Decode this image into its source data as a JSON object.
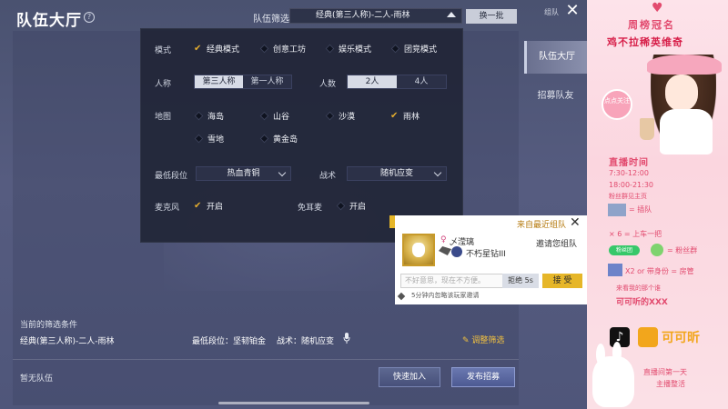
{
  "header": {
    "title": "队伍大厅",
    "help_icon": "help-circle-icon",
    "filter_label": "队伍筛选",
    "filter_value": "经典(第三人称)-二人-雨林",
    "refresh_label": "换一批",
    "tab_small": "组队",
    "close_icon": "close-icon"
  },
  "side_tabs": [
    {
      "label": "队伍大厅",
      "active": true
    },
    {
      "label": "招募队友",
      "active": false
    }
  ],
  "filter": {
    "mode": {
      "label": "模式",
      "options": [
        {
          "label": "经典模式",
          "checked": true
        },
        {
          "label": "创意工坊",
          "checked": false
        },
        {
          "label": "娱乐模式",
          "checked": false
        },
        {
          "label": "团竞模式",
          "checked": false
        }
      ]
    },
    "perspective": {
      "label": "人称",
      "options": [
        {
          "label": "第三人称",
          "selected": true
        },
        {
          "label": "第一人称",
          "selected": false
        }
      ]
    },
    "team_size": {
      "label": "人数",
      "options": [
        {
          "label": "2人",
          "selected": true
        },
        {
          "label": "4人",
          "selected": false
        }
      ]
    },
    "map": {
      "label": "地图",
      "options": [
        {
          "label": "海岛",
          "checked": false
        },
        {
          "label": "山谷",
          "checked": false
        },
        {
          "label": "沙漠",
          "checked": false
        },
        {
          "label": "雨林",
          "checked": true
        },
        {
          "label": "雪地",
          "checked": false
        },
        {
          "label": "黄金岛",
          "checked": false
        }
      ]
    },
    "min_rank": {
      "label": "最低段位",
      "value": "热血青铜"
    },
    "tactic": {
      "label": "战术",
      "value": "随机应变"
    },
    "mic": {
      "label": "麦克风",
      "options": [
        {
          "label": "开启",
          "checked": true
        },
        {
          "label": "免耳麦",
          "checked": false
        },
        {
          "label": "开启",
          "checked": false
        }
      ]
    }
  },
  "current": {
    "title": "当前的筛选条件",
    "mode": "经典(第三人称)-二人-雨林",
    "rank": "最低段位：坚韧铂金",
    "tactic": "战术：随机应变",
    "mic_icon": "microphone-icon",
    "adjust_label": "调整筛选",
    "adjust_icon": "edit-icon"
  },
  "empty_text": "暂无队伍",
  "buttons": {
    "quick_join": "快速加入",
    "publish": "发布招募"
  },
  "invite": {
    "title": "来自最近组队",
    "gender_icon": "female-icon",
    "player": "乄滢璃",
    "rank": "不朽星钻III",
    "invite_text": "邀请您组队",
    "reply_placeholder": "不好意思，现在不方便。",
    "reject_label": "拒绝 5s",
    "accept_label": "接 受",
    "ignore_text": "5分钟内忽略该玩家邀请"
  },
  "stream": {
    "sponsor_title": "周榜冠名",
    "sponsor_name": "鸡不拉稀英维奇",
    "badge_text": "点点关注",
    "schedule_title": "直播时间",
    "schedule_1": "7:30-12:00",
    "schedule_2": "18:00-21:30",
    "schedule_note": "粉丝群见主页",
    "rule_1": "= 插队",
    "rule_2": "× 6 = 上车一把",
    "rule_3_pill": "粉丝团",
    "rule_3": "= 粉丝群",
    "rule_4": "X2 or 带身份 = 房管",
    "rule_5": "来看我的那个谁",
    "rule_6": "可可听的XXX",
    "platform_name": "可可昕",
    "footer_1": "直播间第一天",
    "footer_2": "主播整活"
  },
  "colors": {
    "accent_gold": "#e6b628",
    "stream_pink": "#e24a6e",
    "panel_dark": "#222638"
  }
}
